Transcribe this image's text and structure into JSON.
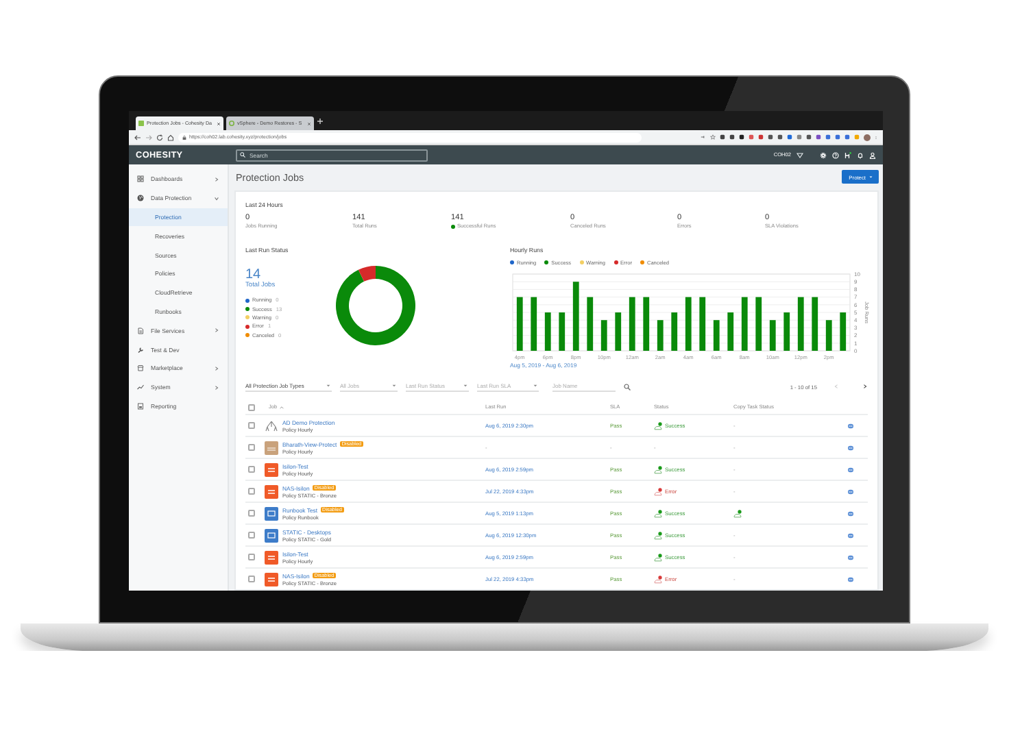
{
  "browser": {
    "tabs": [
      {
        "title": "Protection Jobs - Cohesity Da",
        "selected": true
      },
      {
        "title": "vSphere - Demo Restores - S",
        "selected": false
      }
    ],
    "url": "https://coh02.lab.cohesity.xyz/protection/jobs"
  },
  "header": {
    "logo": "COHESITY",
    "search": {
      "placeholder": "Search"
    },
    "cluster": "COH02"
  },
  "sidebar": {
    "items": [
      {
        "label": "Dashboards",
        "expanded": false,
        "selected": false
      },
      {
        "label": "Data Protection",
        "expanded": true,
        "selected": false,
        "children": [
          {
            "label": "Protection",
            "selected": true
          },
          {
            "label": "Recoveries",
            "selected": false
          },
          {
            "label": "Sources",
            "selected": false
          },
          {
            "label": "Policies",
            "selected": false
          },
          {
            "label": "CloudRetrieve",
            "selected": false
          },
          {
            "label": "Runbooks",
            "selected": false
          }
        ]
      },
      {
        "label": "File Services",
        "expanded": false,
        "selected": false
      },
      {
        "label": "Test & Dev",
        "selected": false
      },
      {
        "label": "Marketplace",
        "expanded": false,
        "selected": false
      },
      {
        "label": "System",
        "expanded": false,
        "selected": false
      },
      {
        "label": "Reporting",
        "selected": false
      }
    ]
  },
  "page": {
    "title": "Protection Jobs",
    "action": "Protect"
  },
  "summary": {
    "title": "Last 24 Hours",
    "stats": [
      {
        "value": "0",
        "label": "Jobs Running"
      },
      {
        "value": "141",
        "label": "Total Runs"
      },
      {
        "value": "141",
        "label": "Successful Runs",
        "color": "#0a8a0a"
      },
      {
        "value": "0",
        "label": "Canceled Runs"
      },
      {
        "value": "0",
        "label": "Errors"
      },
      {
        "value": "0",
        "label": "SLA Violations"
      }
    ]
  },
  "last_run_status": {
    "title": "Last Run Status",
    "total": "14",
    "total_label": "Total Jobs",
    "legend": [
      {
        "count": "0",
        "color": "#1f66c9"
      },
      {
        "count": "13",
        "color": "#0a8a0a"
      },
      {
        "count": "0",
        "color": "#f3cf63"
      },
      {
        "count": "1",
        "color": "#d62a2a"
      },
      {
        "count": "0",
        "color": "#f08c00"
      }
    ],
    "chart_data": {
      "type": "donut",
      "categories": [
        "Running",
        "Success",
        "Warning",
        "Error",
        "Canceled"
      ],
      "values": [
        0,
        92.86,
        0,
        7.14,
        0
      ]
    }
  },
  "hourly_runs": {
    "title": "Hourly Runs",
    "chart_data": {
      "type": "bar",
      "grid": true,
      "ylabel": "Job Runs",
      "categories": [
        "4pm",
        null,
        "6pm",
        null,
        "8pm",
        null,
        "10pm",
        null,
        "12am",
        null,
        "2am",
        null,
        "4am",
        null,
        "6am",
        null,
        "8am",
        null,
        "10am",
        null,
        "12pm",
        null,
        "2pm",
        null
      ],
      "series": [
        {
          "name": "Running",
          "color": "#1f66c9",
          "values": [
            0,
            0,
            0,
            0,
            0,
            0,
            0,
            0,
            0,
            0,
            0,
            0,
            0,
            0,
            0,
            0,
            0,
            0,
            0,
            0,
            0,
            0,
            0,
            0
          ]
        },
        {
          "name": "Success",
          "color": "#0a8a0a",
          "values": [
            7,
            7,
            5,
            5,
            9,
            7,
            4,
            5,
            7,
            7,
            4,
            5,
            7,
            7,
            4,
            5,
            7,
            7,
            4,
            5,
            7,
            7,
            4,
            5
          ]
        },
        {
          "name": "Warning",
          "color": "#f3cf63",
          "values": [
            0,
            0,
            0,
            0,
            0,
            0,
            0,
            0,
            0,
            0,
            0,
            0,
            0,
            0,
            0,
            0,
            0,
            0,
            0,
            0,
            0,
            0,
            0,
            0
          ]
        },
        {
          "name": "Error",
          "color": "#d62a2a",
          "values": [
            0,
            0,
            0,
            0,
            0,
            0,
            0,
            0,
            0,
            0,
            0,
            0,
            0,
            0,
            0,
            0,
            0,
            0,
            0,
            0,
            0,
            0,
            0,
            0
          ]
        },
        {
          "name": "Canceled",
          "color": "#f08c00",
          "values": [
            0,
            0,
            0,
            0,
            0,
            0,
            0,
            0,
            0,
            0,
            0,
            0,
            0,
            0,
            0,
            0,
            0,
            0,
            0,
            0,
            0,
            0,
            0,
            0
          ]
        }
      ],
      "ylim": [
        0,
        10
      ],
      "yticks": [
        0,
        1,
        2,
        3,
        4,
        5,
        6,
        7,
        8,
        9,
        10
      ]
    },
    "date_range": "Aug 5, 2019 - Aug 6, 2019"
  },
  "filters": [
    {
      "value": "All Protection Job Types"
    },
    {
      "placeholder": "All Jobs"
    },
    {
      "placeholder": "Last Run Status"
    },
    {
      "placeholder": "Last Run SLA"
    }
  ],
  "job_name": {
    "placeholder": "Job Name"
  },
  "pagination": {
    "range": "1 - 10 of 15",
    "prev_disabled": true,
    "next_disabled": false
  },
  "table": {
    "select_all": {
      "checked": false
    },
    "columns": [
      {
        "label": "Job",
        "sorted": true
      },
      {
        "label": "Last Run"
      },
      {
        "label": "SLA"
      },
      {
        "label": "Status"
      },
      {
        "label": "Copy Task Status"
      }
    ],
    "rows": [
      {
        "checked": false,
        "kind": "ad",
        "name": "AD Demo Protection",
        "policy": "Policy Hourly",
        "last_run": "Aug 6, 2019 2:30pm",
        "sla": "Pass",
        "status": {
          "kind": "success",
          "label": "Success"
        },
        "copy_task": {
          "label": "-"
        }
      },
      {
        "checked": false,
        "kind": "view",
        "name": "Bharath-View-Protect",
        "tag": "Disabled",
        "policy": "Policy Hourly",
        "last_run": "-",
        "sla": "-",
        "status": {
          "label": "-"
        },
        "copy_task": {
          "label": "-"
        }
      },
      {
        "checked": false,
        "kind": "nas",
        "name": "Isilon-Test",
        "policy": "Policy Hourly",
        "last_run": "Aug 6, 2019 2:59pm",
        "sla": "Pass",
        "status": {
          "kind": "success",
          "label": "Success"
        },
        "copy_task": {
          "label": "-"
        }
      },
      {
        "checked": false,
        "kind": "nas",
        "name": "NAS-Isilon",
        "tag": "Disabled",
        "policy": "Policy STATIC - Bronze",
        "last_run": "Jul 22, 2019 4:33pm",
        "sla": "Pass",
        "status": {
          "kind": "error",
          "label": "Error"
        },
        "copy_task": {
          "label": "-"
        }
      },
      {
        "checked": false,
        "kind": "vm",
        "name": "Runbook Test",
        "tag": "Disabled",
        "policy": "Policy Runbook",
        "last_run": "Aug 5, 2019 1:13pm",
        "sla": "Pass",
        "status": {
          "kind": "success",
          "label": "Success"
        },
        "copy_task": {
          "kind": "success"
        }
      },
      {
        "checked": false,
        "kind": "vm",
        "name": "STATIC - Desktops",
        "policy": "Policy STATIC - Gold",
        "last_run": "Aug 6, 2019 12:30pm",
        "sla": "Pass",
        "status": {
          "kind": "success",
          "label": "Success"
        },
        "copy_task": {
          "label": "-"
        }
      },
      {
        "checked": false,
        "kind": "nas",
        "name": "Isilon-Test",
        "policy": "Policy Hourly",
        "last_run": "Aug 6, 2019 2:59pm",
        "sla": "Pass",
        "status": {
          "kind": "success",
          "label": "Success"
        },
        "copy_task": {
          "label": "-"
        }
      },
      {
        "checked": false,
        "kind": "nas",
        "name": "NAS-Isilon",
        "tag": "Disabled",
        "policy": "Policy STATIC - Bronze",
        "last_run": "Jul 22, 2019 4:33pm",
        "sla": "Pass",
        "status": {
          "kind": "error",
          "label": "Error"
        },
        "copy_task": {
          "label": "-"
        }
      }
    ]
  }
}
